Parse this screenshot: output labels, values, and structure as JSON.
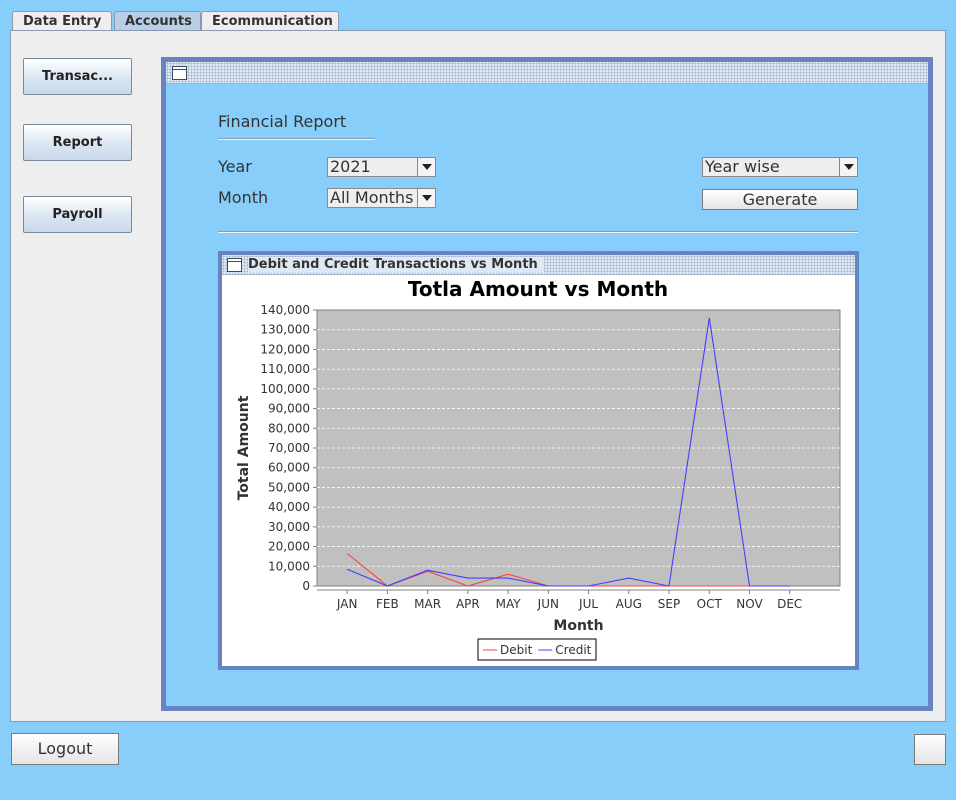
{
  "tabs": [
    {
      "label": "Data Entry",
      "active": false
    },
    {
      "label": "Accounts",
      "active": true
    },
    {
      "label": "Ecommunication",
      "active": false
    }
  ],
  "sidebar": {
    "items": [
      {
        "label": "Transac..."
      },
      {
        "label": "Report"
      },
      {
        "label": "Payroll"
      }
    ]
  },
  "report": {
    "heading": "Financial Report",
    "year_label": "Year",
    "year_value": "2021",
    "month_label": "Month",
    "month_value": "All Months",
    "mode_value": "Year wise",
    "generate_label": "Generate"
  },
  "chart_window": {
    "title": "Debit and Credit Transactions vs Month"
  },
  "chart_data": {
    "type": "line",
    "title": "Totla Amount vs Month",
    "xlabel": "Month",
    "ylabel": "Total Amount",
    "categories": [
      "JAN",
      "FEB",
      "MAR",
      "APR",
      "MAY",
      "JUN",
      "JUL",
      "AUG",
      "SEP",
      "OCT",
      "NOV",
      "DEC"
    ],
    "ylim": [
      0,
      140000
    ],
    "yticks": [
      "0",
      "10,000",
      "20,000",
      "30,000",
      "40,000",
      "50,000",
      "60,000",
      "70,000",
      "80,000",
      "90,000",
      "100,000",
      "110,000",
      "120,000",
      "130,000",
      "140,000"
    ],
    "grid": true,
    "legend_position": "bottom",
    "series": [
      {
        "name": "Debit",
        "color": "#ff4040",
        "values": [
          16500,
          0,
          7500,
          0,
          6000,
          0,
          0,
          0,
          0,
          0,
          0,
          0
        ]
      },
      {
        "name": "Credit",
        "color": "#4040ff",
        "values": [
          8500,
          0,
          8000,
          4000,
          4000,
          0,
          0,
          4000,
          0,
          136000,
          0,
          0
        ]
      }
    ]
  },
  "footer": {
    "logout_label": "Logout"
  }
}
